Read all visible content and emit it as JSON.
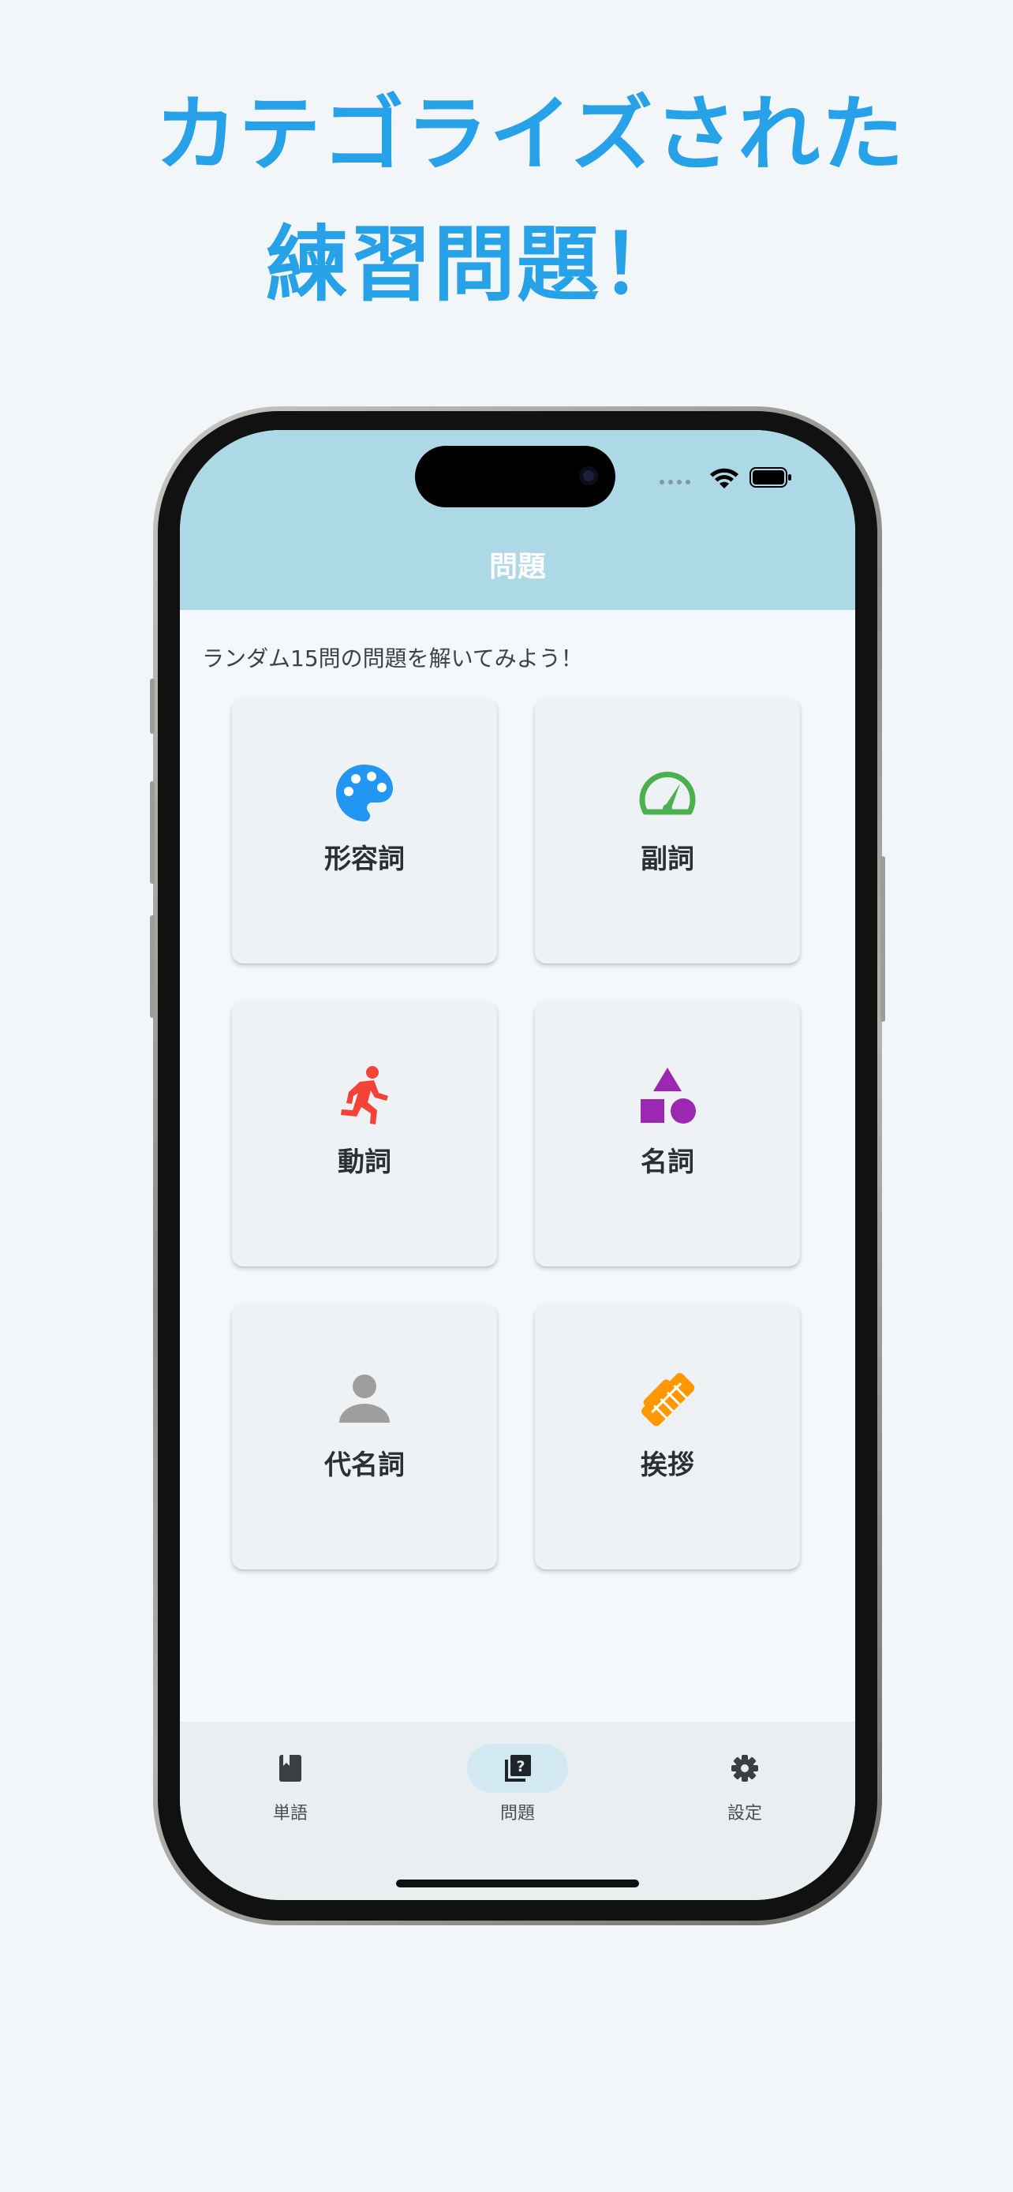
{
  "promo": {
    "headline_line1": "カテゴライズされた",
    "headline_line2": "練習問題！"
  },
  "colors": {
    "headline": "#27a2e8",
    "header_bg": "#add8e6",
    "card_bg": "#eef2f5",
    "nav_bg": "#e9eef1"
  },
  "header": {
    "title": "問題"
  },
  "main": {
    "subtitle": "ランダム15問の問題を解いてみよう！",
    "categories": [
      {
        "label": "形容詞",
        "icon": "palette-icon",
        "color": "#2196f3"
      },
      {
        "label": "副詞",
        "icon": "speed-icon",
        "color": "#4caf50"
      },
      {
        "label": "動詞",
        "icon": "running-person-icon",
        "color": "#f44336"
      },
      {
        "label": "名詞",
        "icon": "shapes-icon",
        "color": "#9c27b0"
      },
      {
        "label": "代名詞",
        "icon": "person-icon",
        "color": "#9e9e9e"
      },
      {
        "label": "挨拶",
        "icon": "handshake-icon",
        "color": "#ff9800"
      }
    ]
  },
  "bottom_nav": {
    "items": [
      {
        "label": "単語",
        "icon": "book-icon",
        "active": false
      },
      {
        "label": "問題",
        "icon": "quiz-icon",
        "active": true
      },
      {
        "label": "設定",
        "icon": "gear-icon",
        "active": false
      }
    ]
  }
}
